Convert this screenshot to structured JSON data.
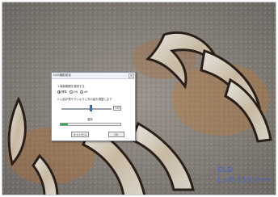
{
  "dialog": {
    "title": "DLD撮影設定",
    "section_label": "1 撮影範囲を選択する",
    "radio_options": [
      {
        "label": "標準",
        "selected": true
      },
      {
        "label": "ON",
        "selected": false
      },
      {
        "label": "off",
        "selected": false
      }
    ],
    "hint_text": "2 山谷が見やすいように光の量を調整します",
    "slider_value": "140",
    "progress_label": "進捗",
    "progress_fraction": 0.12,
    "cancel_label": "キャンセル",
    "ok_label": "OK",
    "close_glyph": "×",
    "accent_color": "#21b24a"
  },
  "measurement": {
    "label": "DLD",
    "readout": "L=0.911 mm",
    "color": "#4e63b8"
  }
}
